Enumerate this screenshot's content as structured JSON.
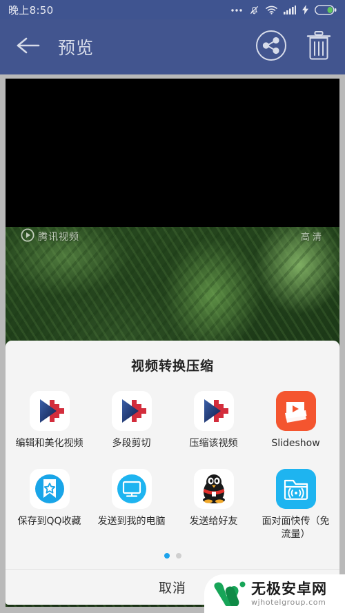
{
  "status_bar": {
    "time": "晚上8:50",
    "icons": [
      "more-dots-icon",
      "alarm-off-icon",
      "wifi-icon",
      "signal-bars-icon",
      "charging-bolt-icon",
      "battery-icon"
    ],
    "background_color": "#3f5490",
    "text_color": "#e8eaf2"
  },
  "app_bar": {
    "title": "预览",
    "back_icon": "arrow-left-icon",
    "share_icon": "share-nodes-icon",
    "delete_icon": "trash-icon",
    "background_color": "#42558f",
    "title_color": "#d7dcea"
  },
  "video": {
    "watermark_label": "腾讯视频",
    "play_icon": "play-circle-icon",
    "quality_label": "高清"
  },
  "share_sheet": {
    "title": "视频转换压缩",
    "background_color": "#f4f4f4",
    "rows": [
      [
        {
          "label": "编辑和美化视频",
          "icon": "video-editor-app-icon",
          "icon_style": "qq-video-edit"
        },
        {
          "label": "多段剪切",
          "icon": "video-editor-app-icon",
          "icon_style": "qq-video-edit"
        },
        {
          "label": "压缩该视频",
          "icon": "video-editor-app-icon",
          "icon_style": "qq-video-edit"
        },
        {
          "label": "Slideshow",
          "icon": "slideshow-app-icon",
          "icon_style": "slideshow"
        }
      ],
      [
        {
          "label": "保存到QQ收藏",
          "icon": "qq-favorites-icon",
          "icon_style": "favorites"
        },
        {
          "label": "发送到我的电脑",
          "icon": "my-computer-icon",
          "icon_style": "computer"
        },
        {
          "label": "发送给好友",
          "icon": "qq-penguin-icon",
          "icon_style": "penguin"
        },
        {
          "label": "面对面快传（免流量）",
          "icon": "face-to-face-transfer-icon",
          "icon_style": "f2f"
        }
      ]
    ],
    "pagination": {
      "total": 2,
      "active_index": 0,
      "active_color": "#1ca3ec",
      "inactive_color": "#cfcfcf"
    },
    "cancel_label": "取消"
  },
  "watermark": {
    "logo_icon": "w-logo-icon",
    "title": "无极安卓网",
    "url": "wjhotelgroup.com",
    "logo_color": "#18a558"
  }
}
